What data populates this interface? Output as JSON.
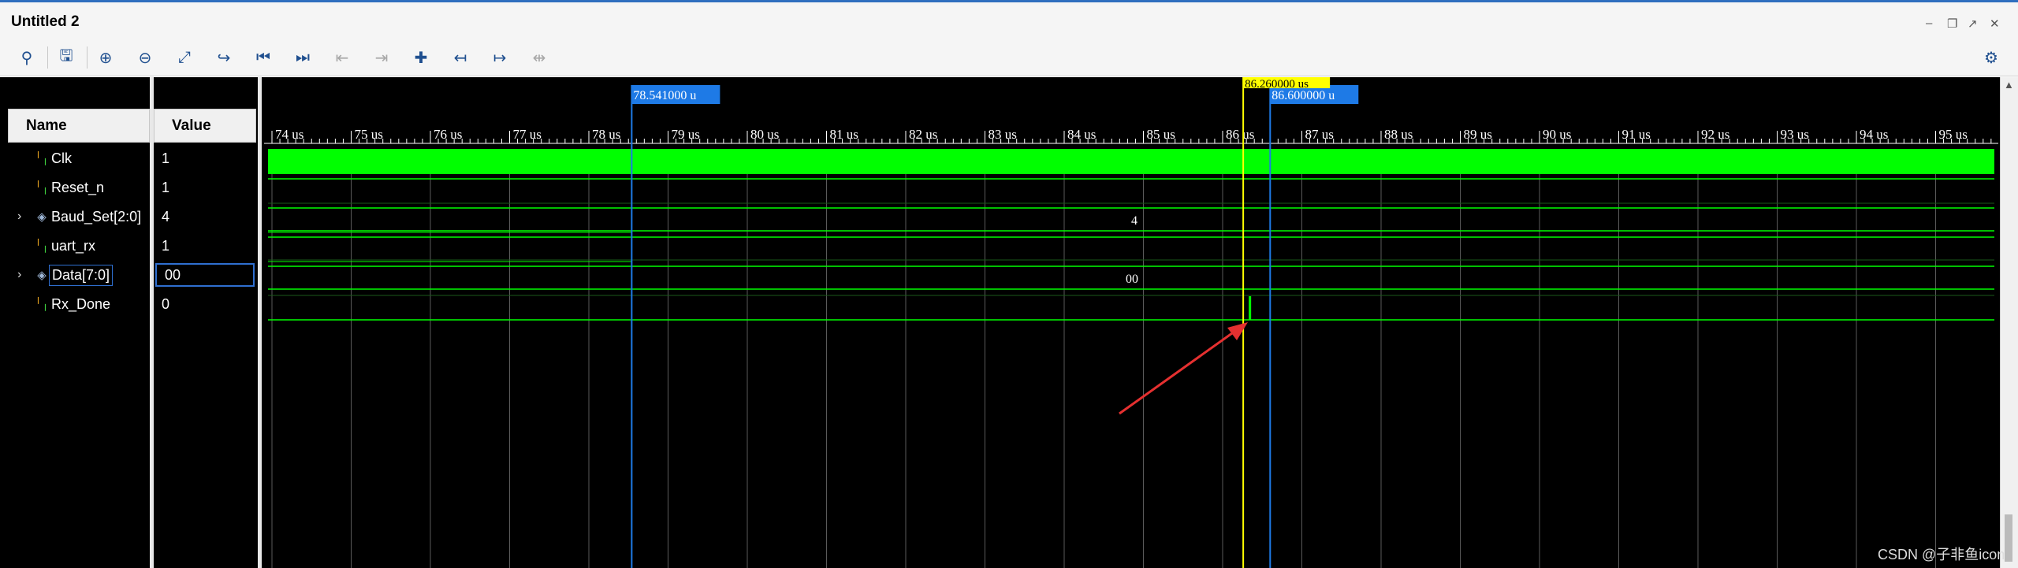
{
  "window": {
    "title": "Untitled 2"
  },
  "toolbar": {
    "icons": [
      "search-icon",
      "save-icon",
      "zoom-in-icon",
      "zoom-out-icon",
      "zoom-fit-icon",
      "go-to-cursor-icon",
      "go-to-time-0-icon",
      "go-to-last-time-icon",
      "previous-transition-icon",
      "next-transition-icon",
      "add-marker-icon",
      "previous-marker-icon",
      "next-marker-icon",
      "swap-cursors-icon"
    ],
    "settings_icon": "gear-icon"
  },
  "columns": {
    "name": "Name",
    "value": "Value"
  },
  "signals": [
    {
      "name": "Clk",
      "value": "1",
      "expandable": false,
      "icon": "bit-signal-icon"
    },
    {
      "name": "Reset_n",
      "value": "1",
      "expandable": false,
      "icon": "bit-signal-icon"
    },
    {
      "name": "Baud_Set[2:0]",
      "value": "4",
      "expandable": true,
      "icon": "bus-signal-icon"
    },
    {
      "name": "uart_rx",
      "value": "1",
      "expandable": false,
      "icon": "bit-signal-icon"
    },
    {
      "name": "Data[7:0]",
      "value": "00",
      "expandable": true,
      "icon": "bus-signal-icon",
      "selected": true
    },
    {
      "name": "Rx_Done",
      "value": "0",
      "expandable": false,
      "icon": "bit-signal-icon"
    }
  ],
  "timeline": {
    "ticks": [
      "74 us",
      "75 us",
      "76 us",
      "77 us",
      "78 us",
      "79 us",
      "80 us",
      "81 us",
      "82 us",
      "83 us",
      "84 us",
      "85 us",
      "86 us",
      "87 us",
      "88 us",
      "89 us",
      "90 us",
      "91 us",
      "92 us",
      "93 us",
      "94 us",
      "95 us"
    ],
    "tick_start": 74,
    "tick_step": 1,
    "bus_labels": {
      "baud_set": "4",
      "data": "00"
    },
    "markers": [
      {
        "label": "78.541000 u",
        "time_us": 78.541,
        "color": "#1e7ae6"
      },
      {
        "label": "86.600000 u",
        "time_us": 86.6,
        "color": "#1e7ae6"
      }
    ],
    "cursor": {
      "label": "86.260000 us",
      "time_us": 86.26,
      "color": "#ffff00"
    },
    "colors": {
      "wave": "#00ff00",
      "grid": "#3a3a3a",
      "bg": "#000000",
      "annotation": "#e53030"
    }
  },
  "watermark": "CSDN @子非鱼icon"
}
